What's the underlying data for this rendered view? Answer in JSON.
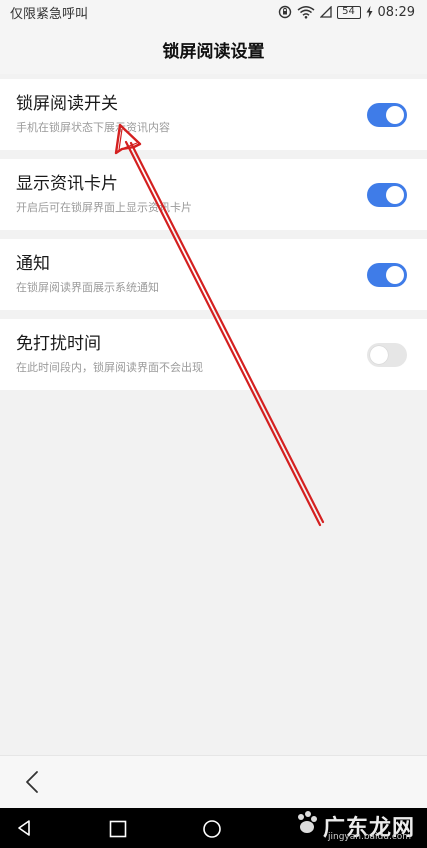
{
  "status_bar": {
    "carrier": "仅限紧急呼叫",
    "battery": "54",
    "time": "08:29"
  },
  "header": {
    "title": "锁屏阅读设置"
  },
  "settings": [
    {
      "title": "锁屏阅读开关",
      "description": "手机在锁屏状态下展示资讯内容",
      "enabled": true
    },
    {
      "title": "显示资讯卡片",
      "description": "开启后可在锁屏界面上显示资讯卡片",
      "enabled": true
    },
    {
      "title": "通知",
      "description": "在锁屏阅读界面展示系统通知",
      "enabled": true
    },
    {
      "title": "免打扰时间",
      "description": "在此时间段内，锁屏阅读界面不会出现",
      "enabled": false
    }
  ],
  "colors": {
    "toggle_on": "#3f7ce8",
    "toggle_off": "#e6e6e6",
    "annotation_arrow": "#d42020"
  },
  "watermark": {
    "text": "广东龙网",
    "url": "jingyan.baidu.com"
  }
}
